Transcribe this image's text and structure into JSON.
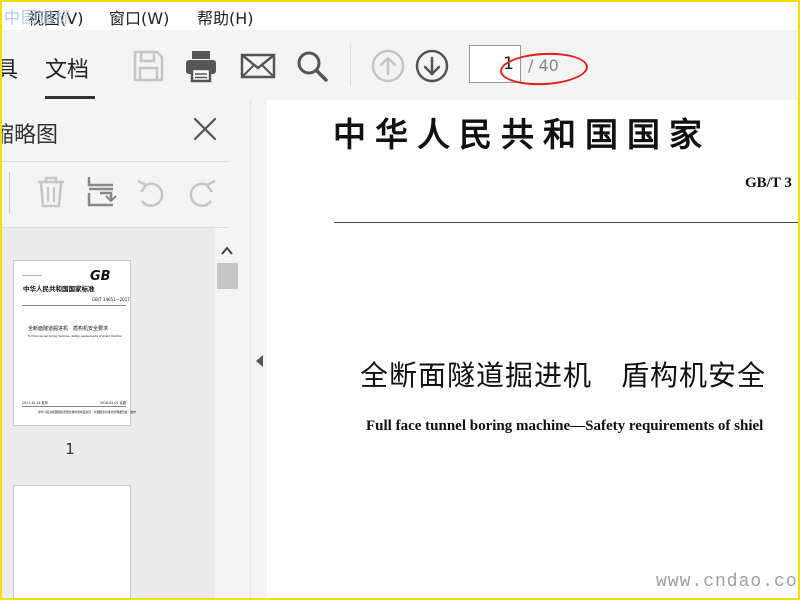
{
  "menu": {
    "items": [
      "视图(V)",
      "窗口(W)",
      "帮助(H)"
    ]
  },
  "watermark": {
    "top_left": "中国道标",
    "bottom_right": "www.cndao.com"
  },
  "toolbar": {
    "tab_partial": "具",
    "tab_document": "文档",
    "icons": [
      "save-icon",
      "print-icon",
      "mail-icon",
      "search-icon",
      "arrow-up-icon",
      "arrow-down-icon"
    ],
    "page_current": "1",
    "page_total": "/ 40",
    "annotation_color": "#e02020"
  },
  "sidebar": {
    "title": "缩略图",
    "icons": [
      "delete-icon",
      "crop-icon",
      "rotate-left-icon",
      "rotate-right-icon",
      "close-icon"
    ],
    "thumbnails": [
      {
        "label": "1",
        "logo": "GB",
        "header": "中华人民共和国国家标准",
        "code": "GB/T 34651—2017",
        "title": "全断面隧道掘进机　盾构机安全要求",
        "subtitle": "Full face tunnel boring machine—Safety requirements of shield machine",
        "footer_left": "2017-10-14 发布",
        "footer_right": "2018-05-01 实施",
        "footer_org": "中华人民共和国国家质量监督检验检疫总局　中国国家标准化管理委员会　发布"
      }
    ]
  },
  "document": {
    "header": "中华人民共和国国家",
    "code": "GB/T 3",
    "title": "全断面隧道掘进机　盾构机安全",
    "subtitle": "Full face tunnel boring machine—Safety requirements of shiel"
  }
}
